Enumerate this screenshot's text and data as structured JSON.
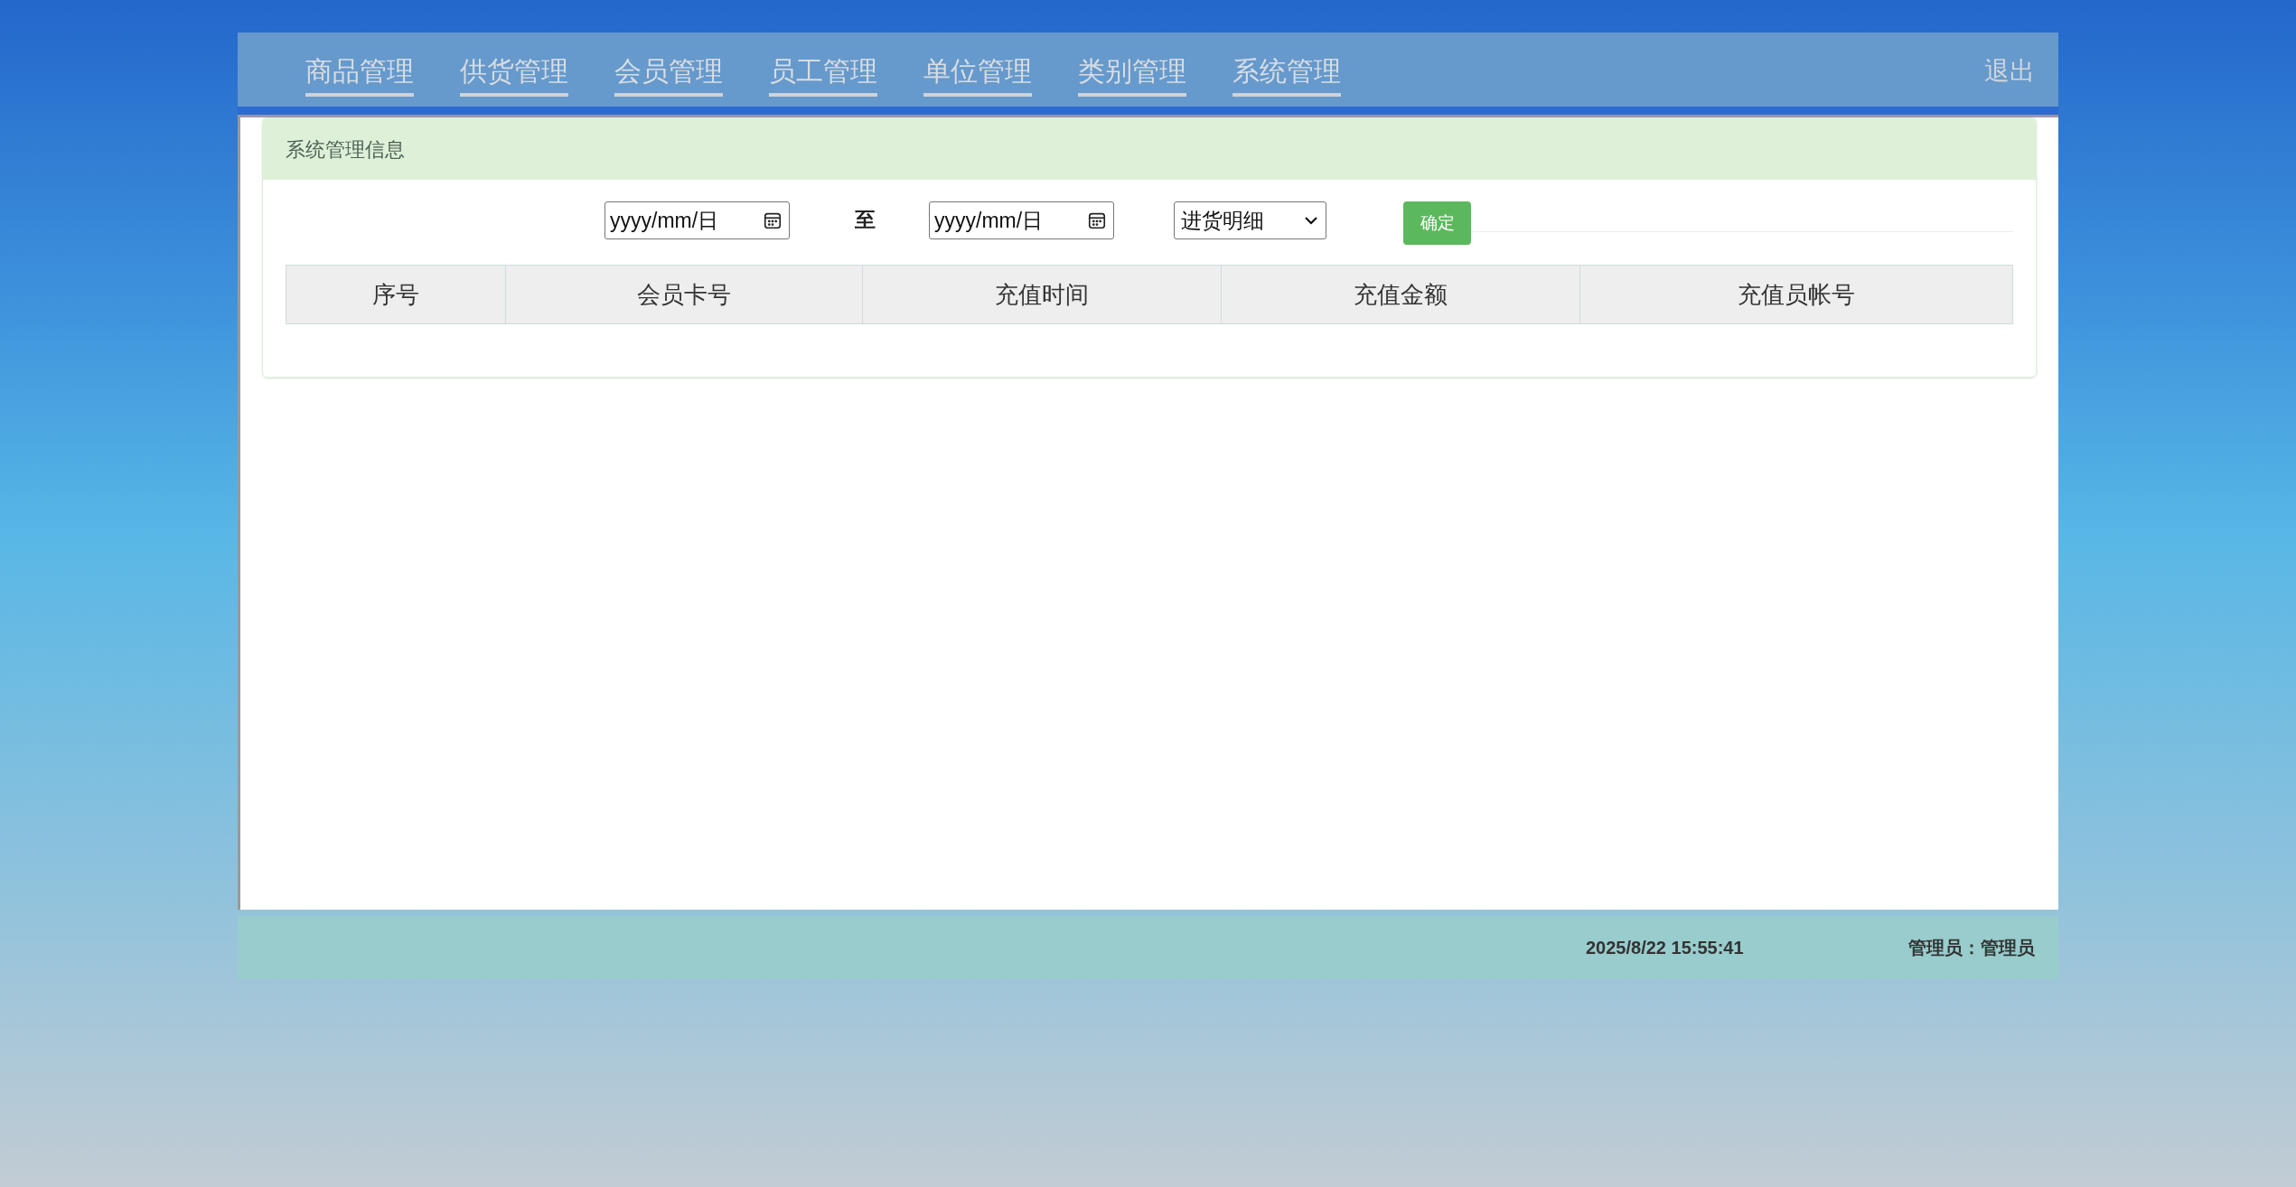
{
  "nav": {
    "items": [
      {
        "label": "商品管理"
      },
      {
        "label": "供货管理"
      },
      {
        "label": "会员管理"
      },
      {
        "label": "员工管理"
      },
      {
        "label": "单位管理"
      },
      {
        "label": "类别管理"
      },
      {
        "label": "系统管理"
      }
    ],
    "logout": "退出"
  },
  "panel": {
    "title": "系统管理信息"
  },
  "filter": {
    "start_date": {
      "placeholder": "yyyy/mm/日"
    },
    "separator": "至",
    "end_date": {
      "placeholder": "yyyy/mm/日"
    },
    "type_select": {
      "value": "进货明细"
    },
    "confirm_button": "确定"
  },
  "table": {
    "columns": [
      "序号",
      "会员卡号",
      "充值时间",
      "充值金额",
      "充值员帐号"
    ]
  },
  "status_bar": {
    "time": "2025/8/22 15:55:41",
    "user": "管理员：管理员"
  }
}
